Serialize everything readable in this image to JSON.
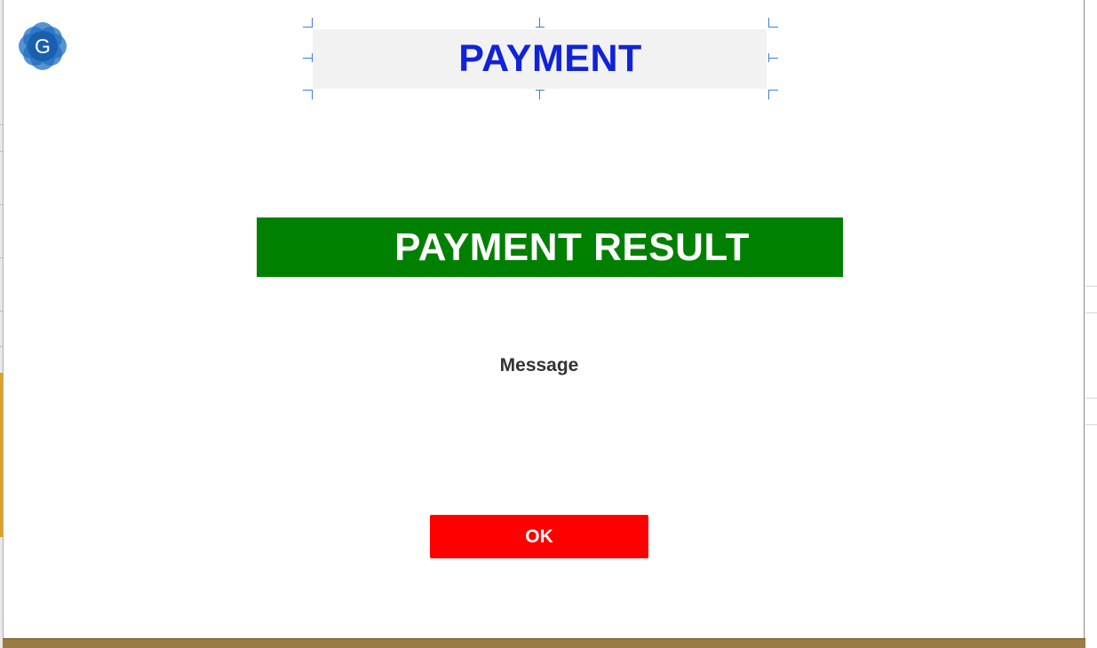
{
  "dialog": {
    "title": "PAYMENT",
    "result_banner": "PAYMENT RESULT",
    "message": "Message",
    "ok_label": "OK"
  },
  "logo": {
    "icon": "g-letter-logo-icon",
    "letter": "G"
  },
  "colors": {
    "title_text": "#1023d8",
    "title_background": "#f2f2f2",
    "result_banner_background": "#008000",
    "result_banner_text": "#ffffff",
    "ok_button_background": "#ff0000",
    "ok_button_text": "#ffffff",
    "message_text": "#333333",
    "logo_blue": "#1f6fc1",
    "selection_handles": "#3b7fd9"
  }
}
